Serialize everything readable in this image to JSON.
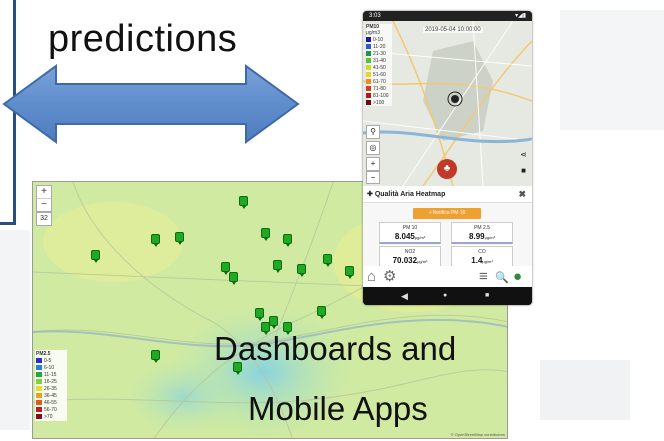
{
  "slide": {
    "arrow_label": "predictions",
    "dashboard_caption_line1": "Dashboards and",
    "dashboard_caption_line2": "Mobile Apps"
  },
  "dashboard": {
    "zoom_in": "+",
    "zoom_out": "−",
    "layers_button": "32",
    "legend_title": "PM2.5",
    "legend": [
      {
        "label": "0-5",
        "color": "#2b2bd6"
      },
      {
        "label": "6-10",
        "color": "#2f7be0"
      },
      {
        "label": "11-15",
        "color": "#1ea64b"
      },
      {
        "label": "16-25",
        "color": "#7fd33a"
      },
      {
        "label": "26-35",
        "color": "#e0e02a"
      },
      {
        "label": "36-45",
        "color": "#f0a020"
      },
      {
        "label": "46-55",
        "color": "#e05a1a"
      },
      {
        "label": "56-70",
        "color": "#c41a1a"
      },
      {
        "label": ">70",
        "color": "#7a1020"
      }
    ],
    "attribution": "© OpenStreetMap contributors"
  },
  "phone": {
    "status_time": "3:03",
    "status_right": "▾◢▮",
    "date_label": "2019-05-04 10:00:00",
    "legend_title": "PM10",
    "legend_unit": "μg/m3",
    "legend": [
      {
        "label": "0-10",
        "color": "#1a1aa8"
      },
      {
        "label": "11-20",
        "color": "#2a5ad6"
      },
      {
        "label": "21-30",
        "color": "#1a9a3a"
      },
      {
        "label": "31-40",
        "color": "#4cc63a"
      },
      {
        "label": "41-50",
        "color": "#c8e02a"
      },
      {
        "label": "51-60",
        "color": "#f0d020"
      },
      {
        "label": "61-70",
        "color": "#f08a20"
      },
      {
        "label": "71-80",
        "color": "#e03a1a"
      },
      {
        "label": "81-100",
        "color": "#b01818"
      },
      {
        "label": ">100",
        "color": "#6a0a10"
      }
    ],
    "panel_title": "Qualità Aria Heatmap",
    "panel_close": "✖",
    "notify_button": "+ Notifica PM 10",
    "cards": [
      {
        "label": "PM 10",
        "value": "8.045",
        "unit": "μg/m³"
      },
      {
        "label": "PM 2.5",
        "value": "8.99",
        "unit": "μg/m³"
      },
      {
        "label": "NO2",
        "value": "70.032",
        "unit": "μg/m³"
      },
      {
        "label": "CO",
        "value": "1.4",
        "unit": "μg/m³"
      }
    ],
    "tab_home": "⌂",
    "tab_settings": "⚙",
    "tab_menu": "≡",
    "tab_search": "🔍",
    "tab_user": "●",
    "nav_back": "◀",
    "nav_home": "●",
    "nav_recent": "■"
  }
}
